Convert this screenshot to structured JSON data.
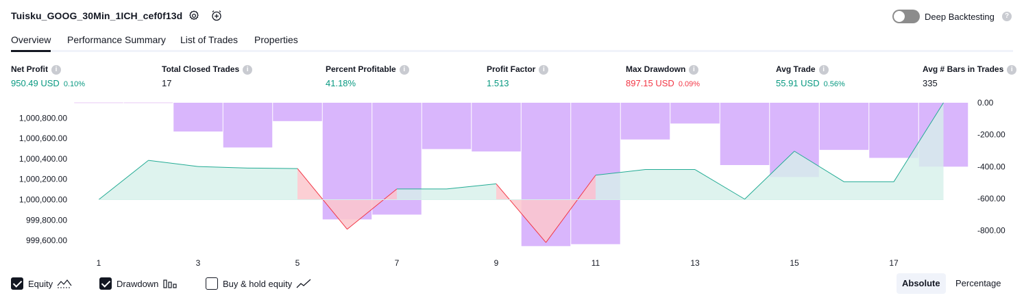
{
  "header": {
    "strategy_name": "Tuisku_GOOG_30Min_1ICH_cef0f13d",
    "deep_backtesting_label": "Deep Backtesting",
    "deep_backtesting_enabled": false
  },
  "tabs": [
    {
      "label": "Overview",
      "active": true
    },
    {
      "label": "Performance Summary",
      "active": false
    },
    {
      "label": "List of Trades",
      "active": false
    },
    {
      "label": "Properties",
      "active": false
    }
  ],
  "metrics": {
    "net_profit": {
      "label": "Net Profit",
      "value": "950.49 USD",
      "pct": "0.10%"
    },
    "total_closed_trades": {
      "label": "Total Closed Trades",
      "value": "17"
    },
    "percent_profitable": {
      "label": "Percent Profitable",
      "value": "41.18%"
    },
    "profit_factor": {
      "label": "Profit Factor",
      "value": "1.513"
    },
    "max_drawdown": {
      "label": "Max Drawdown",
      "value": "897.15 USD",
      "pct": "0.09%"
    },
    "avg_trade": {
      "label": "Avg Trade",
      "value": "55.91 USD",
      "pct": "0.56%"
    },
    "avg_bars": {
      "label": "Avg # Bars in Trades",
      "value": "335"
    }
  },
  "chart_data": {
    "type": "line",
    "x_tick_labels": [
      "1",
      "3",
      "5",
      "7",
      "9",
      "11",
      "13",
      "15",
      "17"
    ],
    "left_axis_labels": [
      "1,000,800.00",
      "1,000,600.00",
      "1,000,400.00",
      "1,000,200.00",
      "1,000,000.00",
      "999,800.00",
      "999,600.00"
    ],
    "right_axis_labels": [
      "0.00",
      "-200.00",
      "-400.00",
      "-600.00",
      "-800.00"
    ],
    "equity_baseline": 1000000,
    "equity_ylim": [
      999540,
      1000950
    ],
    "drawdown_ylim": [
      -900,
      0
    ],
    "series": [
      {
        "name": "Equity",
        "x": [
          1,
          2,
          3,
          4,
          5,
          6,
          7,
          8,
          9,
          10,
          11,
          12,
          13,
          14,
          15,
          16,
          17,
          18
        ],
        "values": [
          1000000,
          1000385,
          1000325,
          1000310,
          1000305,
          999710,
          1000105,
          1000105,
          1000155,
          999580,
          1000240,
          1000295,
          1000295,
          1000005,
          1000475,
          1000175,
          1000175,
          1000950
        ]
      },
      {
        "name": "Drawdown",
        "x": [
          1,
          2,
          3,
          4,
          5,
          6,
          7,
          8,
          9,
          10,
          11,
          12,
          13,
          14,
          15,
          16,
          17,
          18
        ],
        "values": [
          0,
          0,
          -180,
          -280,
          -115,
          -730,
          -700,
          -290,
          -305,
          -897.15,
          -885,
          -230,
          -130,
          -390,
          -465,
          -295,
          -345,
          -400
        ]
      }
    ],
    "colors": {
      "equity_line": "#22ab94",
      "equity_area": "#d6f0ea",
      "loss_line": "#f23645",
      "loss_area": "#fcc7cd",
      "drawdown_bar": "#d9b6fc"
    }
  },
  "legend": [
    {
      "label": "Equity",
      "checked": true,
      "icon": "equity-line-icon"
    },
    {
      "label": "Drawdown",
      "checked": true,
      "icon": "drawdown-bars-icon"
    },
    {
      "label": "Buy & hold equity",
      "checked": false,
      "icon": "buy-hold-line-icon"
    }
  ],
  "scale_toggle": {
    "absolute_label": "Absolute",
    "percentage_label": "Percentage",
    "selected": "Absolute"
  }
}
